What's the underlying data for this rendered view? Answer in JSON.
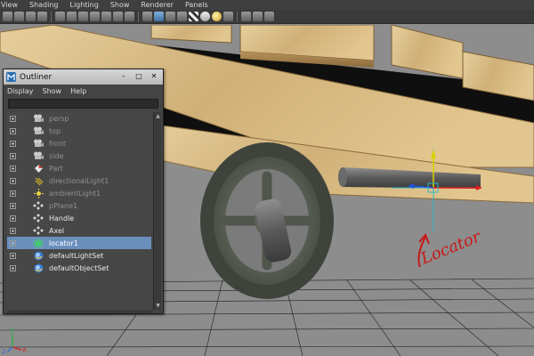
{
  "menu": [
    "View",
    "Shading",
    "Lighting",
    "Show",
    "Renderer",
    "Panels"
  ],
  "outliner": {
    "title": "Outliner",
    "window_buttons": [
      "–",
      "□",
      "✕"
    ],
    "menu": [
      "Display",
      "Show",
      "Help"
    ],
    "items": [
      {
        "label": "persp",
        "icon": "camera-icon",
        "state": "dim"
      },
      {
        "label": "top",
        "icon": "camera-icon",
        "state": "dim"
      },
      {
        "label": "front",
        "icon": "camera-icon",
        "state": "dim"
      },
      {
        "label": "side",
        "icon": "camera-icon",
        "state": "dim"
      },
      {
        "label": "Part",
        "icon": "mesh-icon",
        "state": "dim"
      },
      {
        "label": "directionalLight1",
        "icon": "directional-light-icon",
        "state": "dim"
      },
      {
        "label": "ambientLight1",
        "icon": "ambient-light-icon",
        "state": "dim"
      },
      {
        "label": "pPlane1",
        "icon": "transform-icon",
        "state": "dim"
      },
      {
        "label": "Handle",
        "icon": "transform-icon",
        "state": "norm"
      },
      {
        "label": "Axel",
        "icon": "transform-icon",
        "state": "norm"
      },
      {
        "label": "locator1",
        "icon": "locator-icon",
        "state": "sel"
      },
      {
        "label": "defaultLightSet",
        "icon": "set-icon",
        "state": "norm"
      },
      {
        "label": "defaultObjectSet",
        "icon": "set-icon",
        "state": "norm"
      }
    ]
  },
  "annotation": {
    "text": "Locator",
    "color": "#c81818"
  },
  "axis": {
    "x": "x",
    "y": "y",
    "z": "z"
  },
  "colors": {
    "selection": "#6a8fbd",
    "locator": "#2db8c4",
    "wood": "#d9c08a"
  }
}
